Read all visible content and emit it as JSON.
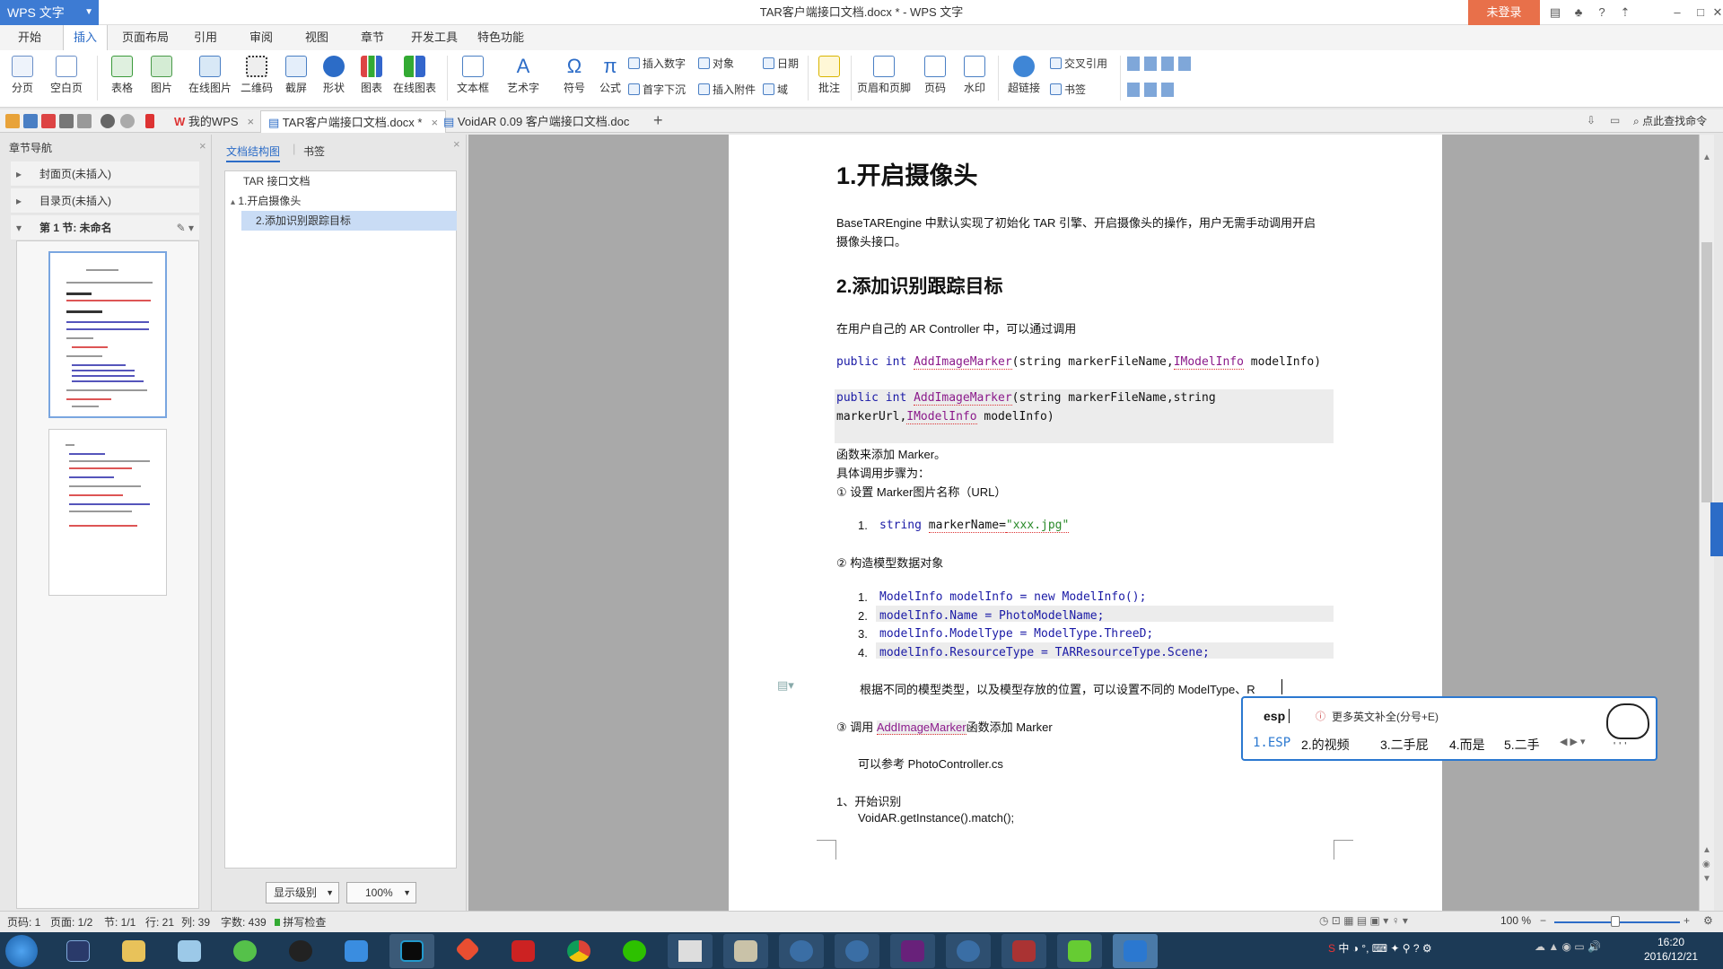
{
  "app": {
    "logo_label": "WPS 文字",
    "window_title": "TAR客户端接口文档.docx * - WPS 文字",
    "login_label": "未登录",
    "help_label": "?"
  },
  "menu": [
    "开始",
    "插入",
    "页面布局",
    "引用",
    "审阅",
    "视图",
    "章节",
    "开发工具",
    "特色功能"
  ],
  "menu_active": "插入",
  "ribbon": {
    "big": [
      "分页",
      "空白页",
      "表格",
      "图片",
      "在线图片",
      "二维码",
      "截屏",
      "形状",
      "图表",
      "在线图表",
      "文本框",
      "艺术字",
      "符号",
      "公式"
    ],
    "small_a": [
      "插入数字",
      "首字下沉"
    ],
    "small_b": [
      "对象",
      "插入附件"
    ],
    "small_c": [
      "日期",
      "域"
    ],
    "big2": [
      "批注",
      "页眉和页脚",
      "页码",
      "水印",
      "超链接"
    ],
    "small_d": [
      "交叉引用",
      "书签"
    ]
  },
  "tabs": [
    {
      "label": "我的WPS"
    },
    {
      "label": "TAR客户端接口文档.docx *"
    },
    {
      "label": "VoidAR 0.09 客户端接口文档.doc"
    }
  ],
  "search_cmd": "点此查找命令",
  "nav_panel": {
    "title": "章节导航",
    "items": [
      "封面页(未插入)",
      "目录页(未插入)",
      "第 1 节: 未命名"
    ]
  },
  "struct_panel": {
    "tab1": "文档结构图",
    "tab2": "书签",
    "nodes": [
      "TAR 接口文档",
      "1.开启摄像头",
      "2.添加识别跟踪目标"
    ],
    "level_btn": "显示级别",
    "zoom_btn": "100%"
  },
  "doc": {
    "h1": "1.开启摄像头",
    "p1a": "BaseTAREngine 中默认实现了初始化 TAR 引擎、开启摄像头的操作，用户无需手动调用开启",
    "p1b": "摄像头接口。",
    "h2": "2.添加识别跟踪目标",
    "p2": "在用户自己的 AR Controller 中，可以通过调用",
    "code1": {
      "kw": "public int ",
      "fn": "AddImageMarker",
      "rest": "(string markerFileName,",
      "ty": "IModelInfo",
      "end": " modelInfo)"
    },
    "code2a": {
      "kw": "public int ",
      "fn": "AddImageMarker",
      "rest": "(string markerFileName,string"
    },
    "code2b": {
      "pre": "markerUrl,",
      "ty": "IModelInfo",
      "end": " modelInfo)"
    },
    "p3": "函数来添加 Marker。",
    "p4": "具体调用步骤为：",
    "p5": "①  设置 Marker图片名称（URL）",
    "l1_num": "1.",
    "l1": {
      "kw": "string ",
      "var": "markerName=",
      "str": "\"xxx.jpg\""
    },
    "p6": "②  构造模型数据对象",
    "code_lines": [
      {
        "num": "1.",
        "text": "ModelInfo modelInfo = new ModelInfo();"
      },
      {
        "num": "2.",
        "text": "modelInfo.Name = PhotoModelName;"
      },
      {
        "num": "3.",
        "text": "modelInfo.ModelType = ModelType.ThreeD;"
      },
      {
        "num": "4.",
        "text": "modelInfo.ResourceType = TARResourceType.Scene;"
      }
    ],
    "p7": "根据不同的模型类型，以及模型存放的位置，可以设置不同的 ModelType、R",
    "p8a": "③  调用 ",
    "p8b": "AddImageMarker",
    "p8c": "函数添加 Marker",
    "p9": "可以参考 PhotoController.cs",
    "p10": "1、开始识别",
    "p11": "VoidAR.getInstance().match();"
  },
  "ime": {
    "input": "esp",
    "hint": "更多英文补全(分号+E)",
    "candidates": [
      "1.ESP",
      "2.的视频",
      "3.二手屁",
      "4.而是",
      "5.二手"
    ]
  },
  "status": {
    "page": "页码: 1",
    "pages": "页面: 1/2",
    "section": "节: 1/1",
    "row": "行: 21",
    "col": "列: 39",
    "words": "字数: 439",
    "spell": "拼写检查",
    "zoom": "100 %"
  },
  "taskbar": {
    "time": "16:20",
    "date": "2016/12/21",
    "ime_tray": "中"
  },
  "colors": {
    "accent": "#2c6cc7",
    "wps_blue": "#3d7bd3",
    "login": "#e8704a",
    "taskbar": "#1c3a56",
    "ime_border": "#2b78d0"
  }
}
